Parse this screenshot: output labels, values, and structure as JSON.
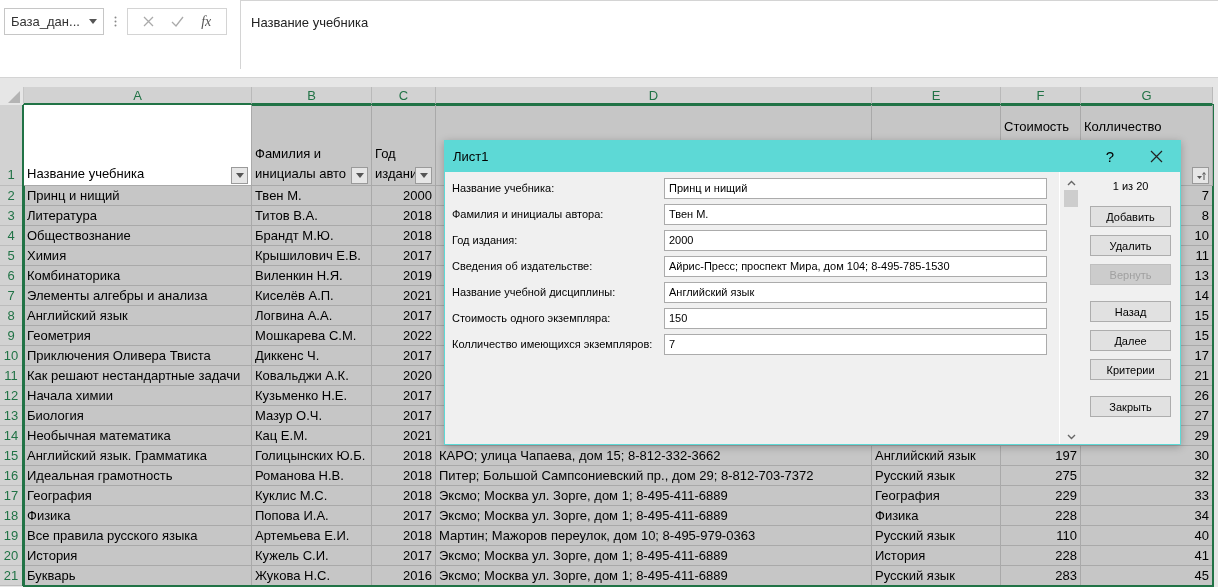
{
  "name_box": {
    "value": "База_дан..."
  },
  "formula_bar": {
    "fx": "fx",
    "value": "Название учебника"
  },
  "sheet": {
    "columns": [
      "A",
      "B",
      "C",
      "D",
      "E",
      "F",
      "G"
    ],
    "header_row": {
      "number": "1",
      "cells": {
        "A": {
          "text": "Название учебника",
          "filter": true,
          "sorted": false
        },
        "B": {
          "text": "Фамилия и инициалы авто",
          "filter": true,
          "sorted": false
        },
        "C": {
          "text": "Год издани",
          "filter": true,
          "sorted": false
        },
        "F": {
          "text": "Стоимость"
        },
        "G": {
          "text": "Колличество",
          "filter": true,
          "sorted": true
        }
      }
    },
    "rows": [
      {
        "number": "2",
        "cells": {
          "A": "Принц и нищий",
          "B": "Твен М.",
          "C": "2000",
          "G": "7"
        }
      },
      {
        "number": "3",
        "cells": {
          "A": "Литература",
          "B": "Титов В.А.",
          "C": "2018",
          "G": "8"
        }
      },
      {
        "number": "4",
        "cells": {
          "A": "Обществознание",
          "B": "Брандт М.Ю.",
          "C": "2018",
          "G": "10"
        }
      },
      {
        "number": "5",
        "cells": {
          "A": "Химия",
          "B": "Крышилович Е.В.",
          "C": "2017",
          "G": "11"
        }
      },
      {
        "number": "6",
        "cells": {
          "A": "Комбинаторика",
          "B": "Виленкин Н.Я.",
          "C": "2019",
          "G": "13"
        }
      },
      {
        "number": "7",
        "cells": {
          "A": "Элементы алгебры и анализа",
          "B": "Киселёв А.П.",
          "C": "2021",
          "G": "14"
        }
      },
      {
        "number": "8",
        "cells": {
          "A": "Английский язык",
          "B": "Логвина А.А.",
          "C": "2017",
          "G": "15"
        }
      },
      {
        "number": "9",
        "cells": {
          "A": "Геометрия",
          "B": "Мошкарева С.М.",
          "C": "2022",
          "G": "15"
        }
      },
      {
        "number": "10",
        "cells": {
          "A": "Приключения Оливера Твиста",
          "B": "Диккенс Ч.",
          "C": "2017",
          "G": "17"
        }
      },
      {
        "number": "11",
        "cells": {
          "A": "Как решают нестандартные задачи",
          "B": "Ковальджи А.К.",
          "C": "2020",
          "G": "21"
        }
      },
      {
        "number": "12",
        "cells": {
          "A": "Начала химии",
          "B": "Кузьменко Н.Е.",
          "C": "2017",
          "G": "26"
        }
      },
      {
        "number": "13",
        "cells": {
          "A": "Биология",
          "B": "Мазур О.Ч.",
          "C": "2017",
          "G": "27"
        }
      },
      {
        "number": "14",
        "cells": {
          "A": "Необычная математика",
          "B": "Кац Е.М.",
          "C": "2021",
          "G": "29"
        }
      },
      {
        "number": "15",
        "cells": {
          "A": "Английский язык. Грамматика",
          "B": "Голицынских Ю.Б.",
          "C": "2018",
          "D": "КАРО; улица Чапаева, дом 15; 8-812-332-3662",
          "E": "Английский язык",
          "F": "197",
          "G": "30"
        }
      },
      {
        "number": "16",
        "cells": {
          "A": "Идеальная грамотность",
          "B": "Романова Н.В.",
          "C": "2018",
          "D": "Питер; Большой Сампсониевский пр., дом 29; 8-812-703-7372",
          "E": "Русский язык",
          "F": "275",
          "G": "32"
        }
      },
      {
        "number": "17",
        "cells": {
          "A": "География",
          "B": "Куклис М.С.",
          "C": "2018",
          "D": "Эксмо; Москва ул. Зорге, дом 1; 8-495-411-6889",
          "E": "География",
          "F": "229",
          "G": "33"
        }
      },
      {
        "number": "18",
        "cells": {
          "A": "Физика",
          "B": "Попова И.А.",
          "C": "2017",
          "D": "Эксмо; Москва ул. Зорге, дом 1; 8-495-411-6889",
          "E": "Физика",
          "F": "228",
          "G": "34"
        }
      },
      {
        "number": "19",
        "cells": {
          "A": "Все правила русского языка",
          "B": "Артемьева Е.И.",
          "C": "2018",
          "D": "Мартин; Мажоров переулок, дом 10; 8-495-979-0363",
          "E": "Русский язык",
          "F": "110",
          "G": "40"
        }
      },
      {
        "number": "20",
        "cells": {
          "A": "История",
          "B": "Кужель С.И.",
          "C": "2017",
          "D": "Эксмо; Москва ул. Зорге, дом 1; 8-495-411-6889",
          "E": "История",
          "F": "228",
          "G": "41"
        }
      },
      {
        "number": "21",
        "cells": {
          "A": "Букварь",
          "B": "Жукова Н.С.",
          "C": "2016",
          "D": "Эксмо; Москва ул. Зорге, дом 1; 8-495-411-6889",
          "E": "Русский язык",
          "F": "283",
          "G": "45"
        }
      }
    ]
  },
  "dialog": {
    "title": "Лист1",
    "help": "?",
    "fields": [
      {
        "label": "Название учебника:",
        "value": "Принц и нищий"
      },
      {
        "label": "Фамилия и инициалы автора:",
        "value": "Твен М."
      },
      {
        "label": "Год издания:",
        "value": "2000"
      },
      {
        "label": "Сведения об издательстве:",
        "value": "Айрис-Пресс; проспект Мира, дом 104; 8-495-785-1530"
      },
      {
        "label": "Название учебной дисциплины:",
        "value": "Английский язык"
      },
      {
        "label": "Стоимость одного экземпляра:",
        "value": "150"
      },
      {
        "label": "Колличество имеющихся экземпляров:",
        "value": "7"
      }
    ],
    "record_counter": "1 из 20",
    "button_groups": [
      [
        {
          "label": "Добавить",
          "disabled": false
        },
        {
          "label": "Удалить",
          "disabled": false
        },
        {
          "label": "Вернуть",
          "disabled": true
        }
      ],
      [
        {
          "label": "Назад",
          "disabled": false
        },
        {
          "label": "Далее",
          "disabled": false
        },
        {
          "label": "Критерии",
          "disabled": false
        }
      ],
      [
        {
          "label": "Закрыть",
          "disabled": false
        }
      ]
    ]
  }
}
